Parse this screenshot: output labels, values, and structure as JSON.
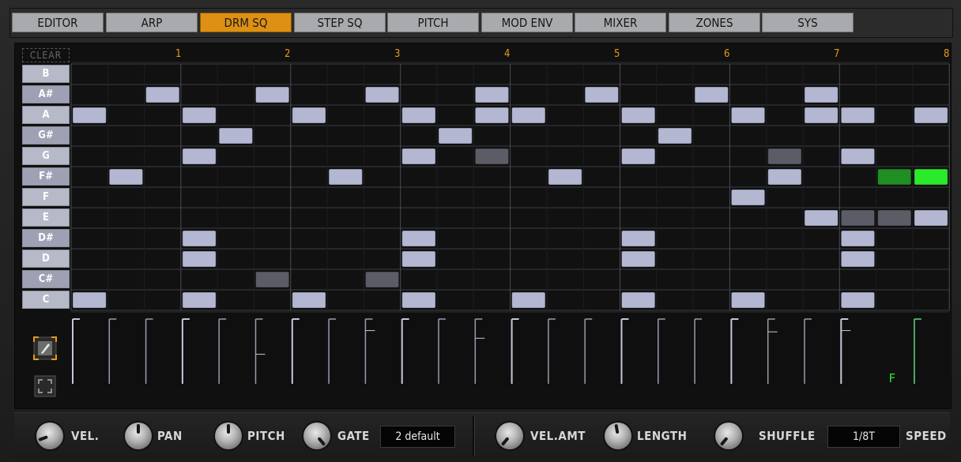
{
  "tabs": [
    {
      "label": "EDITOR",
      "active": false
    },
    {
      "label": "ARP",
      "active": false
    },
    {
      "label": "DRM SQ",
      "active": true
    },
    {
      "label": "STEP SQ",
      "active": false
    },
    {
      "label": "PITCH",
      "active": false
    },
    {
      "label": "MOD ENV",
      "active": false
    },
    {
      "label": "MIXER",
      "active": false
    },
    {
      "label": "ZONES",
      "active": false
    },
    {
      "label": "SYS",
      "active": false
    }
  ],
  "grid": {
    "clear_label": "CLEAR",
    "beats": [
      "1",
      "2",
      "3",
      "4",
      "5",
      "6",
      "7",
      "8"
    ],
    "keys": [
      "B",
      "A#",
      "A",
      "G#",
      "G",
      "F#",
      "F",
      "E",
      "D#",
      "D",
      "C#",
      "C"
    ],
    "steps": 24,
    "notes": [
      {
        "row": 1,
        "step": 2,
        "state": "on"
      },
      {
        "row": 1,
        "step": 5,
        "state": "on"
      },
      {
        "row": 1,
        "step": 8,
        "state": "on"
      },
      {
        "row": 1,
        "step": 11,
        "state": "on"
      },
      {
        "row": 1,
        "step": 14,
        "state": "on"
      },
      {
        "row": 1,
        "step": 17,
        "state": "on"
      },
      {
        "row": 1,
        "step": 20,
        "state": "on"
      },
      {
        "row": 2,
        "step": 0,
        "state": "on"
      },
      {
        "row": 2,
        "step": 3,
        "state": "on"
      },
      {
        "row": 2,
        "step": 6,
        "state": "on"
      },
      {
        "row": 2,
        "step": 9,
        "state": "on"
      },
      {
        "row": 2,
        "step": 11,
        "state": "on"
      },
      {
        "row": 2,
        "step": 12,
        "state": "on"
      },
      {
        "row": 2,
        "step": 15,
        "state": "on"
      },
      {
        "row": 2,
        "step": 18,
        "state": "on"
      },
      {
        "row": 2,
        "step": 20,
        "state": "on"
      },
      {
        "row": 2,
        "step": 21,
        "state": "on"
      },
      {
        "row": 2,
        "step": 23,
        "state": "on"
      },
      {
        "row": 3,
        "step": 4,
        "state": "on"
      },
      {
        "row": 3,
        "step": 10,
        "state": "on"
      },
      {
        "row": 3,
        "step": 16,
        "state": "on"
      },
      {
        "row": 4,
        "step": 3,
        "state": "on"
      },
      {
        "row": 4,
        "step": 9,
        "state": "on"
      },
      {
        "row": 4,
        "step": 11,
        "state": "dim"
      },
      {
        "row": 4,
        "step": 15,
        "state": "on"
      },
      {
        "row": 4,
        "step": 19,
        "state": "dim"
      },
      {
        "row": 4,
        "step": 21,
        "state": "on"
      },
      {
        "row": 5,
        "step": 1,
        "state": "on"
      },
      {
        "row": 5,
        "step": 7,
        "state": "on"
      },
      {
        "row": 5,
        "step": 13,
        "state": "on"
      },
      {
        "row": 5,
        "step": 19,
        "state": "on"
      },
      {
        "row": 5,
        "step": 22,
        "state": "green-dark"
      },
      {
        "row": 5,
        "step": 23,
        "state": "green"
      },
      {
        "row": 6,
        "step": 18,
        "state": "on"
      },
      {
        "row": 7,
        "step": 20,
        "state": "on"
      },
      {
        "row": 7,
        "step": 21,
        "state": "dim"
      },
      {
        "row": 7,
        "step": 22,
        "state": "dim"
      },
      {
        "row": 7,
        "step": 23,
        "state": "on"
      },
      {
        "row": 8,
        "step": 3,
        "state": "on"
      },
      {
        "row": 8,
        "step": 9,
        "state": "on"
      },
      {
        "row": 8,
        "step": 15,
        "state": "on"
      },
      {
        "row": 8,
        "step": 21,
        "state": "on"
      },
      {
        "row": 9,
        "step": 3,
        "state": "on"
      },
      {
        "row": 9,
        "step": 9,
        "state": "on"
      },
      {
        "row": 9,
        "step": 15,
        "state": "on"
      },
      {
        "row": 9,
        "step": 21,
        "state": "on"
      },
      {
        "row": 10,
        "step": 5,
        "state": "dim"
      },
      {
        "row": 10,
        "step": 8,
        "state": "dim"
      },
      {
        "row": 11,
        "step": 0,
        "state": "on"
      },
      {
        "row": 11,
        "step": 3,
        "state": "on"
      },
      {
        "row": 11,
        "step": 6,
        "state": "on"
      },
      {
        "row": 11,
        "step": 9,
        "state": "on"
      },
      {
        "row": 11,
        "step": 12,
        "state": "on"
      },
      {
        "row": 11,
        "step": 15,
        "state": "on"
      },
      {
        "row": 11,
        "step": 18,
        "state": "on"
      },
      {
        "row": 11,
        "step": 21,
        "state": "on"
      }
    ],
    "velocity_markers": [
      {
        "step": 5,
        "level": 0.55
      },
      {
        "step": 8,
        "level": 0.18
      },
      {
        "step": 11,
        "level": 0.3
      },
      {
        "step": 19,
        "level": 0.2
      },
      {
        "step": 21,
        "level": 0.18
      }
    ],
    "active_step": 23,
    "active_step_glyph": "F",
    "colors": {
      "note_on": "#b4b7d2",
      "note_dim": "#5b5c66",
      "green": "#2bea2b",
      "green_dark": "#1f8e23",
      "beat_number": "#e59a1c",
      "tab_active": "#dd9013"
    }
  },
  "tools": [
    {
      "name": "pencil-tool",
      "active": true
    },
    {
      "name": "select-tool",
      "active": false
    }
  ],
  "controls": {
    "vel_label": "VEL.",
    "pan_label": "PAN",
    "pitch_label": "PITCH",
    "gate_label": "GATE",
    "preset_value": "2 default",
    "vel_amt_label": "VEL.AMT",
    "length_label": "LENGTH",
    "shuffle_label": "SHUFFLE",
    "speed_value": "1/8T",
    "speed_label": "SPEED"
  }
}
